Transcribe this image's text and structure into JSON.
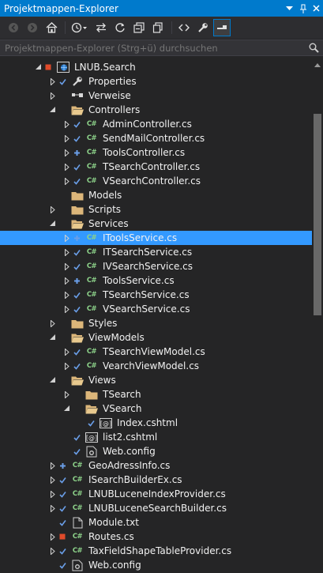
{
  "window": {
    "title": "Projektmappen-Explorer",
    "buttons": [
      "dropdown-icon",
      "pin-icon",
      "close-icon"
    ]
  },
  "toolbar": {
    "icons": [
      "back-icon",
      "forward-icon",
      "home-icon",
      "history-icon",
      "sync-icon",
      "refresh-icon",
      "collapse-all-icon",
      "copy-icon",
      "code-view-icon",
      "properties-icon",
      "preview-icon"
    ]
  },
  "search": {
    "placeholder": "Projektmappen-Explorer (Strg+ü) durchsuchen",
    "value": ""
  },
  "colors": {
    "title_bar": "#007acc",
    "selection": "#3399ff",
    "background": "#252526",
    "folder": "#dcb67a",
    "check": "#6a9ee8",
    "csharp": "#8dd28a"
  },
  "tree": [
    {
      "label": "LNUB.Search",
      "depth": 0,
      "twisty": "open",
      "icon": "web-project-icon",
      "badge": "red"
    },
    {
      "label": "Properties",
      "depth": 1,
      "twisty": "closed",
      "icon": "wrench-icon",
      "badge": "check"
    },
    {
      "label": "Verweise",
      "depth": 1,
      "twisty": "closed",
      "icon": "references-icon",
      "badge": ""
    },
    {
      "label": "Controllers",
      "depth": 1,
      "twisty": "open",
      "icon": "folder-open-icon",
      "badge": ""
    },
    {
      "label": "AdminController.cs",
      "depth": 2,
      "twisty": "closed",
      "icon": "csharp-file-icon",
      "badge": "check"
    },
    {
      "label": "SendMailController.cs",
      "depth": 2,
      "twisty": "closed",
      "icon": "csharp-file-icon",
      "badge": "check"
    },
    {
      "label": "ToolsController.cs",
      "depth": 2,
      "twisty": "closed",
      "icon": "csharp-file-icon",
      "badge": "plus"
    },
    {
      "label": "TSearchController.cs",
      "depth": 2,
      "twisty": "closed",
      "icon": "csharp-file-icon",
      "badge": "check"
    },
    {
      "label": "VSearchController.cs",
      "depth": 2,
      "twisty": "closed",
      "icon": "csharp-file-icon",
      "badge": "check"
    },
    {
      "label": "Models",
      "depth": 1,
      "twisty": "",
      "icon": "folder-icon",
      "badge": ""
    },
    {
      "label": "Scripts",
      "depth": 1,
      "twisty": "closed",
      "icon": "folder-icon",
      "badge": ""
    },
    {
      "label": "Services",
      "depth": 1,
      "twisty": "open",
      "icon": "folder-open-icon",
      "badge": ""
    },
    {
      "label": "IToolsService.cs",
      "depth": 2,
      "twisty": "closed",
      "icon": "csharp-file-icon",
      "badge": "plus",
      "selected": true
    },
    {
      "label": "ITSearchService.cs",
      "depth": 2,
      "twisty": "closed",
      "icon": "csharp-file-icon",
      "badge": "check"
    },
    {
      "label": "IVSearchService.cs",
      "depth": 2,
      "twisty": "closed",
      "icon": "csharp-file-icon",
      "badge": "check"
    },
    {
      "label": "ToolsService.cs",
      "depth": 2,
      "twisty": "closed",
      "icon": "csharp-file-icon",
      "badge": "plus"
    },
    {
      "label": "TSearchService.cs",
      "depth": 2,
      "twisty": "closed",
      "icon": "csharp-file-icon",
      "badge": "check"
    },
    {
      "label": "VSearchService.cs",
      "depth": 2,
      "twisty": "closed",
      "icon": "csharp-file-icon",
      "badge": "check"
    },
    {
      "label": "Styles",
      "depth": 1,
      "twisty": "closed",
      "icon": "folder-icon",
      "badge": ""
    },
    {
      "label": "ViewModels",
      "depth": 1,
      "twisty": "open",
      "icon": "folder-open-icon",
      "badge": ""
    },
    {
      "label": "TSearchViewModel.cs",
      "depth": 2,
      "twisty": "closed",
      "icon": "csharp-file-icon",
      "badge": "check"
    },
    {
      "label": "VearchViewModel.cs",
      "depth": 2,
      "twisty": "closed",
      "icon": "csharp-file-icon",
      "badge": "check"
    },
    {
      "label": "Views",
      "depth": 1,
      "twisty": "open",
      "icon": "folder-open-icon",
      "badge": ""
    },
    {
      "label": "TSearch",
      "depth": 2,
      "twisty": "closed",
      "icon": "folder-icon",
      "badge": ""
    },
    {
      "label": "VSearch",
      "depth": 2,
      "twisty": "open",
      "icon": "folder-open-icon",
      "badge": ""
    },
    {
      "label": "Index.cshtml",
      "depth": 3,
      "twisty": "",
      "icon": "razor-file-icon",
      "badge": "check"
    },
    {
      "label": "list2.cshtml",
      "depth": 2,
      "twisty": "",
      "icon": "razor-file-icon",
      "badge": "check"
    },
    {
      "label": "Web.config",
      "depth": 2,
      "twisty": "",
      "icon": "config-file-icon",
      "badge": "check"
    },
    {
      "label": "GeoAdressInfo.cs",
      "depth": 1,
      "twisty": "closed",
      "icon": "csharp-file-icon",
      "badge": "plus"
    },
    {
      "label": "ISearchBuilderEx.cs",
      "depth": 1,
      "twisty": "closed",
      "icon": "csharp-file-icon",
      "badge": "check"
    },
    {
      "label": "LNUBLuceneIndexProvider.cs",
      "depth": 1,
      "twisty": "closed",
      "icon": "csharp-file-icon",
      "badge": "check"
    },
    {
      "label": "LNUBLuceneSearchBuilder.cs",
      "depth": 1,
      "twisty": "closed",
      "icon": "csharp-file-icon",
      "badge": "check"
    },
    {
      "label": "Module.txt",
      "depth": 1,
      "twisty": "",
      "icon": "text-file-icon",
      "badge": "check"
    },
    {
      "label": "Routes.cs",
      "depth": 1,
      "twisty": "closed",
      "icon": "csharp-file-icon",
      "badge": "red"
    },
    {
      "label": "TaxFieldShapeTableProvider.cs",
      "depth": 1,
      "twisty": "closed",
      "icon": "csharp-file-icon",
      "badge": "check"
    },
    {
      "label": "Web.config",
      "depth": 1,
      "twisty": "",
      "icon": "config-file-icon",
      "badge": "check"
    }
  ]
}
